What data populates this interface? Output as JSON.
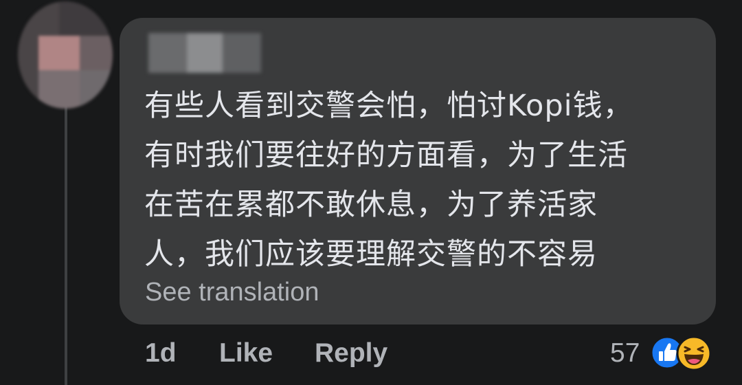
{
  "comment": {
    "lines": [
      "有些人看到交警会怕，怕讨Kopi钱，",
      "有时我们要往好的方面看，为了生活",
      "在苦在累都不敢休息，为了养活家",
      "人，我们应该要理解交警的不容易"
    ],
    "see_translation": "See translation"
  },
  "actions": {
    "time": "1d",
    "like": "Like",
    "reply": "Reply"
  },
  "reactions": {
    "count": "57",
    "icons": [
      "like-icon",
      "haha-icon"
    ]
  },
  "colors": {
    "background": "#18191a",
    "bubble": "#3a3b3c",
    "text": "#e4e6eb",
    "secondary": "#b0b3b8",
    "like_blue": "#1877f2",
    "haha_yellow": "#f7b928"
  }
}
